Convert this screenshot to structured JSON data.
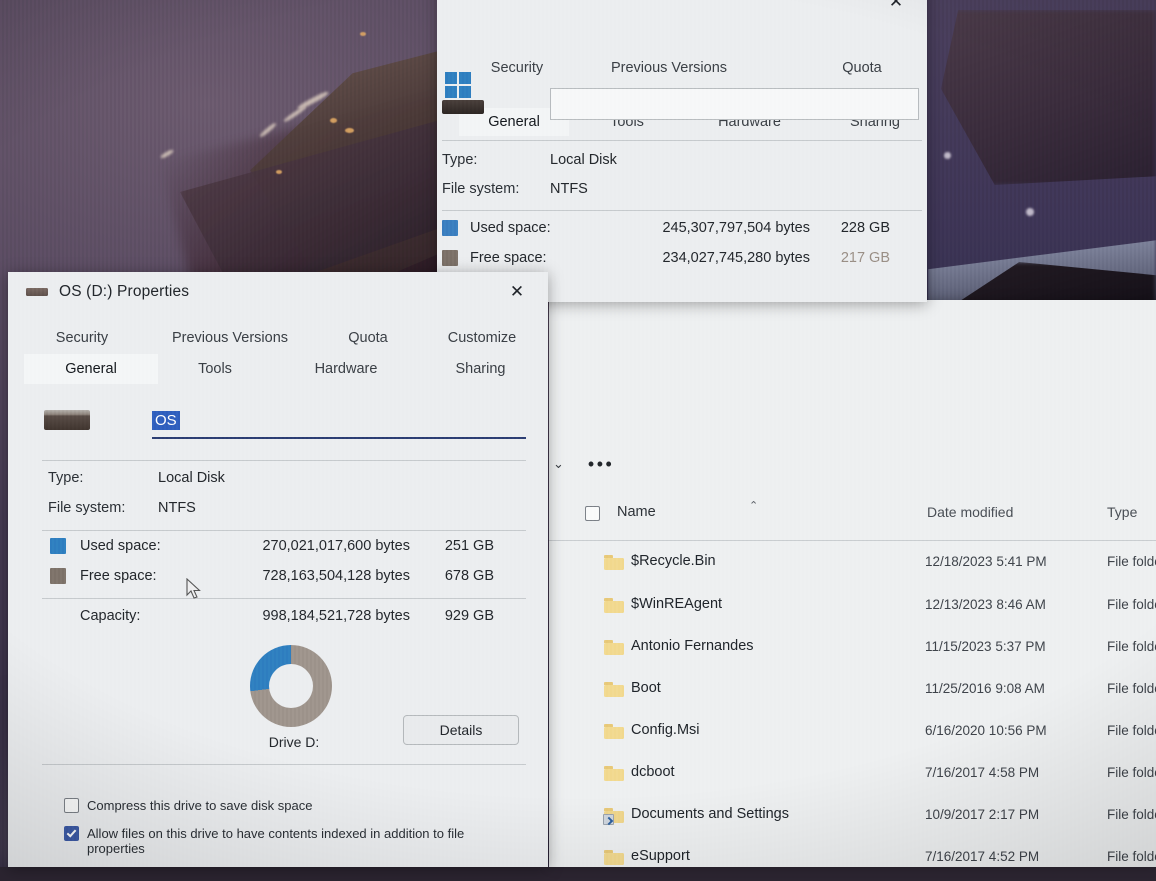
{
  "desktop": {
    "wallpaper_description": "dark purple space scene photographed off a monitor",
    "wallpaper_colors": [
      "#584a60",
      "#453a52",
      "#332b42",
      "#4a3f5c"
    ]
  },
  "back_dialog": {
    "close_label": "✕",
    "tabs_row1": [
      {
        "label": "Security"
      },
      {
        "label": "Previous Versions"
      },
      {
        "label": "Quota"
      }
    ],
    "tabs_row2": [
      {
        "label": "General",
        "active": true
      },
      {
        "label": "Tools"
      },
      {
        "label": "Hardware"
      },
      {
        "label": "Sharing"
      }
    ],
    "volume_label_value": "",
    "fields": [
      {
        "key": "Type:",
        "value": "Local Disk"
      },
      {
        "key": "File system:",
        "value": "NTFS"
      }
    ],
    "space_rows": [
      {
        "label": "Used space:",
        "bytes": "245,307,797,504 bytes",
        "size": "228 GB",
        "color": "#3a7ebf"
      },
      {
        "label": "Free space:",
        "bytes": "234,027,745,280 bytes",
        "size": "217 GB",
        "color": "#7c7168"
      }
    ]
  },
  "explorer": {
    "overflow_label": "•••",
    "chevron_label": "⌄",
    "columns": [
      "Name",
      "Date modified",
      "Type"
    ],
    "sort_indicator": "⌃",
    "rows": [
      {
        "name": "$Recycle.Bin",
        "date": "12/18/2023 5:41 PM",
        "type": "File folder",
        "icon": "folder-icon"
      },
      {
        "name": "$WinREAgent",
        "date": "12/13/2023 8:46 AM",
        "type": "File folder",
        "icon": "folder-icon"
      },
      {
        "name": "Antonio Fernandes",
        "date": "11/15/2023 5:37 PM",
        "type": "File folder",
        "icon": "folder-icon"
      },
      {
        "name": "Boot",
        "date": "11/25/2016 9:08 AM",
        "type": "File folder",
        "icon": "folder-icon"
      },
      {
        "name": "Config.Msi",
        "date": "6/16/2020 10:56 PM",
        "type": "File folder",
        "icon": "folder-icon"
      },
      {
        "name": "dcboot",
        "date": "7/16/2017 4:58 PM",
        "type": "File folder",
        "icon": "folder-icon"
      },
      {
        "name": "Documents and Settings",
        "date": "10/9/2017 2:17 PM",
        "type": "File folder",
        "icon": "folder-shortcut-icon"
      },
      {
        "name": "eSupport",
        "date": "7/16/2017 4:52 PM",
        "type": "File folder",
        "icon": "folder-icon"
      }
    ]
  },
  "front_dialog": {
    "title": "OS (D:) Properties",
    "close_label": "✕",
    "tabs_row1": [
      {
        "label": "Security"
      },
      {
        "label": "Previous Versions"
      },
      {
        "label": "Quota"
      },
      {
        "label": "Customize"
      }
    ],
    "tabs_row2": [
      {
        "label": "General",
        "active": true
      },
      {
        "label": "Tools"
      },
      {
        "label": "Hardware"
      },
      {
        "label": "Sharing"
      }
    ],
    "volume_label_value": "OS",
    "volume_label_selected": true,
    "fields": [
      {
        "key": "Type:",
        "value": "Local Disk"
      },
      {
        "key": "File system:",
        "value": "NTFS"
      }
    ],
    "space_rows": [
      {
        "label": "Used space:",
        "bytes": "270,021,017,600 bytes",
        "size": "251 GB",
        "color": "#2f7fc0"
      },
      {
        "label": "Free space:",
        "bytes": "728,163,504,128 bytes",
        "size": "678 GB",
        "color": "#7e736a"
      }
    ],
    "capacity": {
      "label": "Capacity:",
      "bytes": "998,184,521,728 bytes",
      "size": "929 GB"
    },
    "drive_caption": "Drive D:",
    "details_button": "Details",
    "checkboxes": [
      {
        "label": "Compress this drive to save disk space",
        "checked": false
      },
      {
        "label": "Allow files on this drive to have contents indexed in addition to file properties",
        "checked": true
      }
    ]
  },
  "chart_data": {
    "type": "pie",
    "title": "Drive D:",
    "labels": [
      "Used space",
      "Free space"
    ],
    "values": [
      270021017600,
      728163504128
    ],
    "display_values": [
      "251 GB",
      "678 GB"
    ],
    "percentages": [
      27.05,
      72.95
    ],
    "colors": [
      "#2f7fc0",
      "#9e948c"
    ],
    "legend_position": "above"
  }
}
